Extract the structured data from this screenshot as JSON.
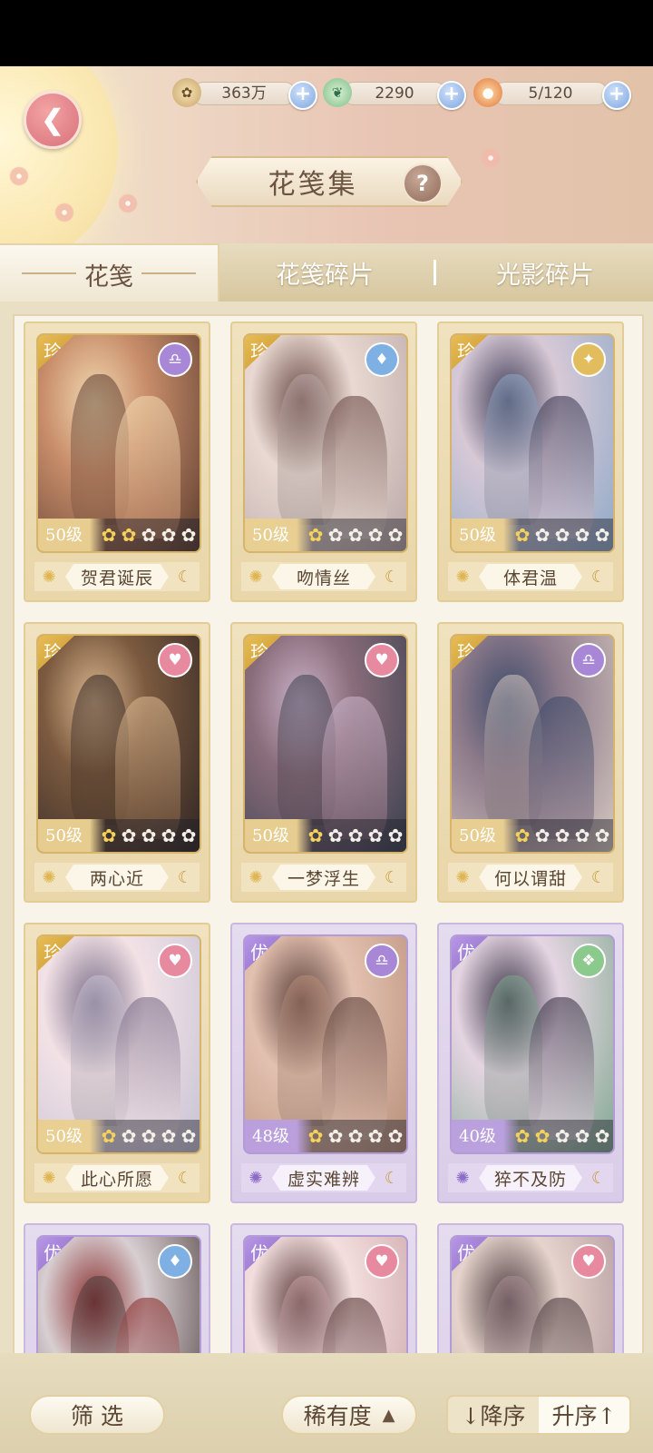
{
  "resources": [
    {
      "name": "coin",
      "icon": "paw-coin-icon",
      "value": "363万"
    },
    {
      "name": "jade",
      "icon": "jade-bird-icon",
      "value": "2290"
    },
    {
      "name": "stamina",
      "icon": "mooncake-icon",
      "value": "5/120"
    }
  ],
  "header": {
    "title": "花笺集",
    "help": "?"
  },
  "tabs": [
    "花笺",
    "花笺碎片",
    "光影碎片"
  ],
  "cards": [
    {
      "rarity": "珍",
      "level": "50级",
      "stars": 2,
      "name": "贺君诞辰",
      "tier": "gold",
      "badge": "♎",
      "badge_color": "#a887d6"
    },
    {
      "rarity": "珍",
      "level": "50级",
      "stars": 1,
      "name": "吻情丝",
      "tier": "gold",
      "badge": "♦",
      "badge_color": "#7fb0e3"
    },
    {
      "rarity": "珍",
      "level": "50级",
      "stars": 1,
      "name": "体君温",
      "tier": "gold",
      "badge": "✦",
      "badge_color": "#e2bd5d"
    },
    {
      "rarity": "珍",
      "level": "50级",
      "stars": 1,
      "name": "两心近",
      "tier": "gold",
      "badge": "♥",
      "badge_color": "#e78aa0"
    },
    {
      "rarity": "珍",
      "level": "50级",
      "stars": 1,
      "name": "一梦浮生",
      "tier": "gold",
      "badge": "♥",
      "badge_color": "#e78aa0"
    },
    {
      "rarity": "珍",
      "level": "50级",
      "stars": 1,
      "name": "何以谓甜",
      "tier": "gold",
      "badge": "♎",
      "badge_color": "#a887d6"
    },
    {
      "rarity": "珍",
      "level": "50级",
      "stars": 1,
      "name": "此心所愿",
      "tier": "gold",
      "badge": "♥",
      "badge_color": "#e78aa0"
    },
    {
      "rarity": "优",
      "level": "48级",
      "stars": 1,
      "name": "虚实难辨",
      "tier": "purple",
      "badge": "♎",
      "badge_color": "#a887d6"
    },
    {
      "rarity": "优",
      "level": "40级",
      "stars": 2,
      "name": "猝不及防",
      "tier": "purple",
      "badge": "❖",
      "badge_color": "#8cc98d"
    },
    {
      "rarity": "优",
      "level": "",
      "stars": 0,
      "name": "",
      "tier": "purple",
      "badge": "♦",
      "badge_color": "#7fb0e3"
    },
    {
      "rarity": "优",
      "level": "",
      "stars": 0,
      "name": "",
      "tier": "purple",
      "badge": "♥",
      "badge_color": "#e78aa0"
    },
    {
      "rarity": "优",
      "level": "",
      "stars": 0,
      "name": "",
      "tier": "purple",
      "badge": "♥",
      "badge_color": "#e78aa0"
    }
  ],
  "footer": {
    "filter_label": "筛 选",
    "rarity_sort_label": "稀有度",
    "desc_label": "↓降序",
    "asc_label": "升序↑"
  }
}
